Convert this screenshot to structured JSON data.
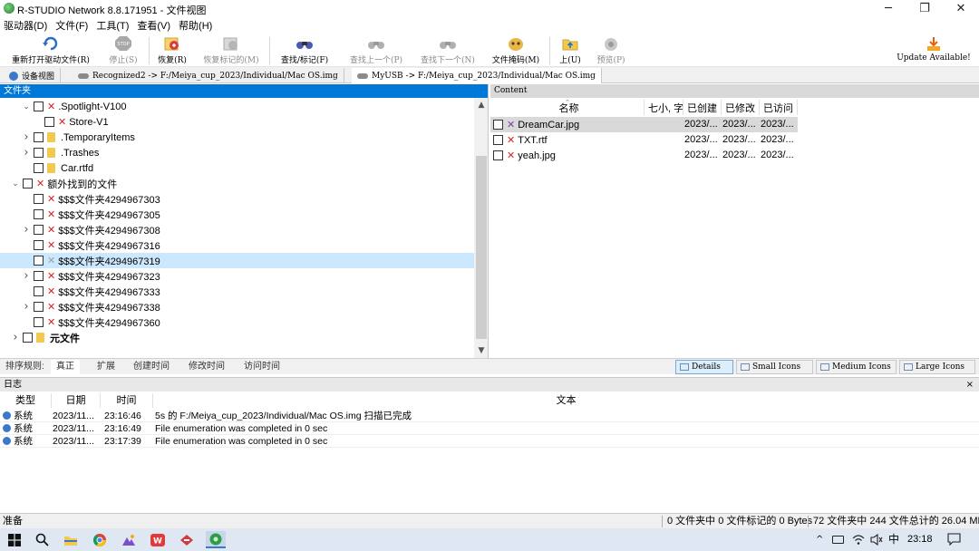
{
  "window": {
    "title": "R-STUDIO Network 8.8.171951 - 文件视图",
    "minimize_glyph": "─",
    "restore_glyph": "❐",
    "close_glyph": "✕"
  },
  "menu": [
    "驱动器(D)",
    "文件(F)",
    "工具(T)",
    "查看(V)",
    "帮助(H)"
  ],
  "toolbar": {
    "buttons": [
      {
        "label": "重新打开驱动文件(R)",
        "icon": "refresh-icon",
        "enabled": true
      },
      {
        "label": "停止(S)",
        "icon": "stop-icon",
        "enabled": false
      },
      {
        "label": "恢复(R)",
        "icon": "recover-icon",
        "enabled": true
      },
      {
        "label": "恢复标记的(M)",
        "icon": "recover-marked-icon",
        "enabled": false
      },
      {
        "label": "查找/标记(F)",
        "icon": "binoculars-icon",
        "enabled": true
      },
      {
        "label": "查找上一个(P)",
        "icon": "find-previous-icon",
        "enabled": false
      },
      {
        "label": "查找下一个(N)",
        "icon": "find-next-icon",
        "enabled": false
      },
      {
        "label": "文件掩码(M)",
        "icon": "file-mask-icon",
        "enabled": true
      },
      {
        "label": "上(U)",
        "icon": "folder-up-icon",
        "enabled": true
      },
      {
        "label": "预览(P)",
        "icon": "preview-icon",
        "enabled": false
      }
    ],
    "update_label": "Update Available!"
  },
  "tabs": [
    {
      "label": "设备视图",
      "active": false
    },
    {
      "label": "Recognized2 -> F:/Meiya_cup_2023/Individual/Mac OS.img",
      "active": false
    },
    {
      "label": "MyUSB -> F:/Meiya_cup_2023/Individual/Mac OS.img",
      "active": true
    }
  ],
  "left_panel": {
    "header": "文件夹",
    "tree": [
      {
        "label": ".Spotlight-V100",
        "expander": "expanded",
        "mark": "x",
        "icon": "none",
        "bold": false,
        "selected": false
      },
      {
        "label": "Store-V1",
        "expander": "none",
        "mark": "x",
        "icon": "none",
        "bold": false,
        "selected": false
      },
      {
        "label": ".TemporaryItems",
        "expander": "collapsed",
        "mark": "none",
        "icon": "folder",
        "bold": false,
        "selected": false
      },
      {
        "label": ".Trashes",
        "expander": "collapsed",
        "mark": "none",
        "icon": "folder",
        "bold": false,
        "selected": false
      },
      {
        "label": "Car.rtfd",
        "expander": "none",
        "mark": "none",
        "icon": "folder",
        "bold": false,
        "selected": false
      },
      {
        "label": "额外找到的文件",
        "expander": "expanded",
        "mark": "x",
        "icon": "none",
        "bold": false,
        "selected": false
      },
      {
        "label": "$$$文件夹4294967303",
        "expander": "none",
        "mark": "x",
        "icon": "none",
        "bold": false,
        "selected": false
      },
      {
        "label": "$$$文件夹4294967305",
        "expander": "none",
        "mark": "x",
        "icon": "none",
        "bold": false,
        "selected": false
      },
      {
        "label": "$$$文件夹4294967308",
        "expander": "collapsed",
        "mark": "x",
        "icon": "none",
        "bold": false,
        "selected": false
      },
      {
        "label": "$$$文件夹4294967316",
        "expander": "none",
        "mark": "x",
        "icon": "none",
        "bold": false,
        "selected": false
      },
      {
        "label": "$$$文件夹4294967319",
        "expander": "none",
        "mark": "x-gray",
        "icon": "none",
        "bold": false,
        "selected": true
      },
      {
        "label": "$$$文件夹4294967323",
        "expander": "collapsed",
        "mark": "x",
        "icon": "none",
        "bold": false,
        "selected": false
      },
      {
        "label": "$$$文件夹4294967333",
        "expander": "none",
        "mark": "x",
        "icon": "none",
        "bold": false,
        "selected": false
      },
      {
        "label": "$$$文件夹4294967338",
        "expander": "collapsed",
        "mark": "x",
        "icon": "none",
        "bold": false,
        "selected": false
      },
      {
        "label": "$$$文件夹4294967360",
        "expander": "none",
        "mark": "x",
        "icon": "none",
        "bold": false,
        "selected": false
      },
      {
        "label": "元文件",
        "expander": "collapsed",
        "mark": "none",
        "icon": "folder",
        "bold": true,
        "selected": false
      }
    ]
  },
  "right_panel": {
    "header": "Content",
    "columns": [
      "名称",
      "七小, 字节",
      "已创建",
      "已修改",
      "已访问"
    ],
    "files": [
      {
        "name": "DreamCar.jpg",
        "created": "2023/...",
        "modified": "2023/...",
        "accessed": "2023/...",
        "selected": true
      },
      {
        "name": "TXT.rtf",
        "created": "2023/...",
        "modified": "2023/...",
        "accessed": "2023/...",
        "selected": false
      },
      {
        "name": "yeah.jpg",
        "created": "2023/...",
        "modified": "2023/...",
        "accessed": "2023/...",
        "selected": false
      }
    ]
  },
  "sort_bar": {
    "label": "排序规则:",
    "options": [
      {
        "label": "真正",
        "active": true
      },
      {
        "label": "扩展",
        "active": false
      },
      {
        "label": "创建时间",
        "active": false
      },
      {
        "label": "修改时间",
        "active": false
      },
      {
        "label": "访问时间",
        "active": false
      }
    ],
    "views": [
      {
        "label": "Details",
        "active": true
      },
      {
        "label": "Small Icons",
        "active": false
      },
      {
        "label": "Medium Icons",
        "active": false
      },
      {
        "label": "Large Icons",
        "active": false
      }
    ]
  },
  "log": {
    "header": "日志",
    "close_glyph": "×",
    "columns": [
      "类型",
      "日期",
      "时间",
      "文本"
    ],
    "rows": [
      {
        "type": "系统",
        "date": "2023/11...",
        "time": "23:16:46",
        "text": "5s 的 F:/Meiya_cup_2023/Individual/Mac OS.img 扫描已完成"
      },
      {
        "type": "系统",
        "date": "2023/11...",
        "time": "23:16:49",
        "text": "File enumeration was completed in 0 sec"
      },
      {
        "type": "系统",
        "date": "2023/11...",
        "time": "23:17:39",
        "text": "File enumeration was completed in 0 sec"
      }
    ]
  },
  "status": {
    "left": "准备",
    "marked": "0 文件夹中 0 文件标记的 0 Bytes",
    "total": "72 文件夹中 244 文件总计的 26.04 MB"
  },
  "taskbar": {
    "clock": "23:18",
    "ime": "中",
    "tray_up": "^"
  },
  "colors": {
    "accent": "#0078d7",
    "selection": "#cce8ff",
    "deleted_mark": "#e02020",
    "folder": "#f2c94c"
  }
}
